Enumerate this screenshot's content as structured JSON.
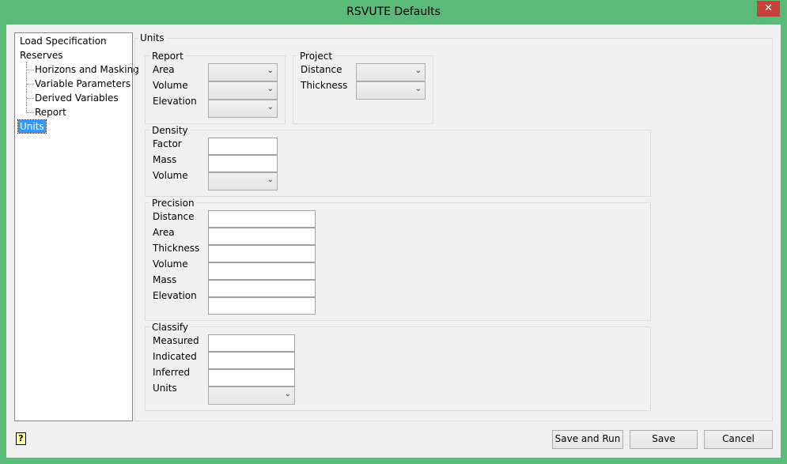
{
  "window": {
    "title": "RSVUTE Defaults",
    "close": "✕"
  },
  "tree": {
    "items": [
      "Load Specification",
      "Reserves",
      "Horizons and Masking",
      "Variable Parameters",
      "Derived Variables",
      "Report",
      "Units"
    ],
    "selected": "Units"
  },
  "units": {
    "title": "Units",
    "report": {
      "title": "Report",
      "labels": [
        "Area",
        "Volume",
        "Elevation"
      ]
    },
    "project": {
      "title": "Project",
      "labels": [
        "Distance",
        "Thickness"
      ]
    },
    "density": {
      "title": "Density",
      "labels": [
        "Factor",
        "Mass",
        "Volume"
      ]
    },
    "precision": {
      "title": "Precision",
      "labels": [
        "Distance",
        "Area",
        "Thickness",
        "Volume",
        "Mass",
        "Elevation"
      ]
    },
    "classify": {
      "title": "Classify",
      "labels": [
        "Measured",
        "Indicated",
        "Inferred",
        "Units"
      ]
    }
  },
  "buttons": {
    "save_run": "Save and Run",
    "save": "Save",
    "cancel": "Cancel",
    "help": "?"
  },
  "colors": {
    "frame": "#5aba78",
    "selection": "#3399ff",
    "close": "#c7413a"
  }
}
